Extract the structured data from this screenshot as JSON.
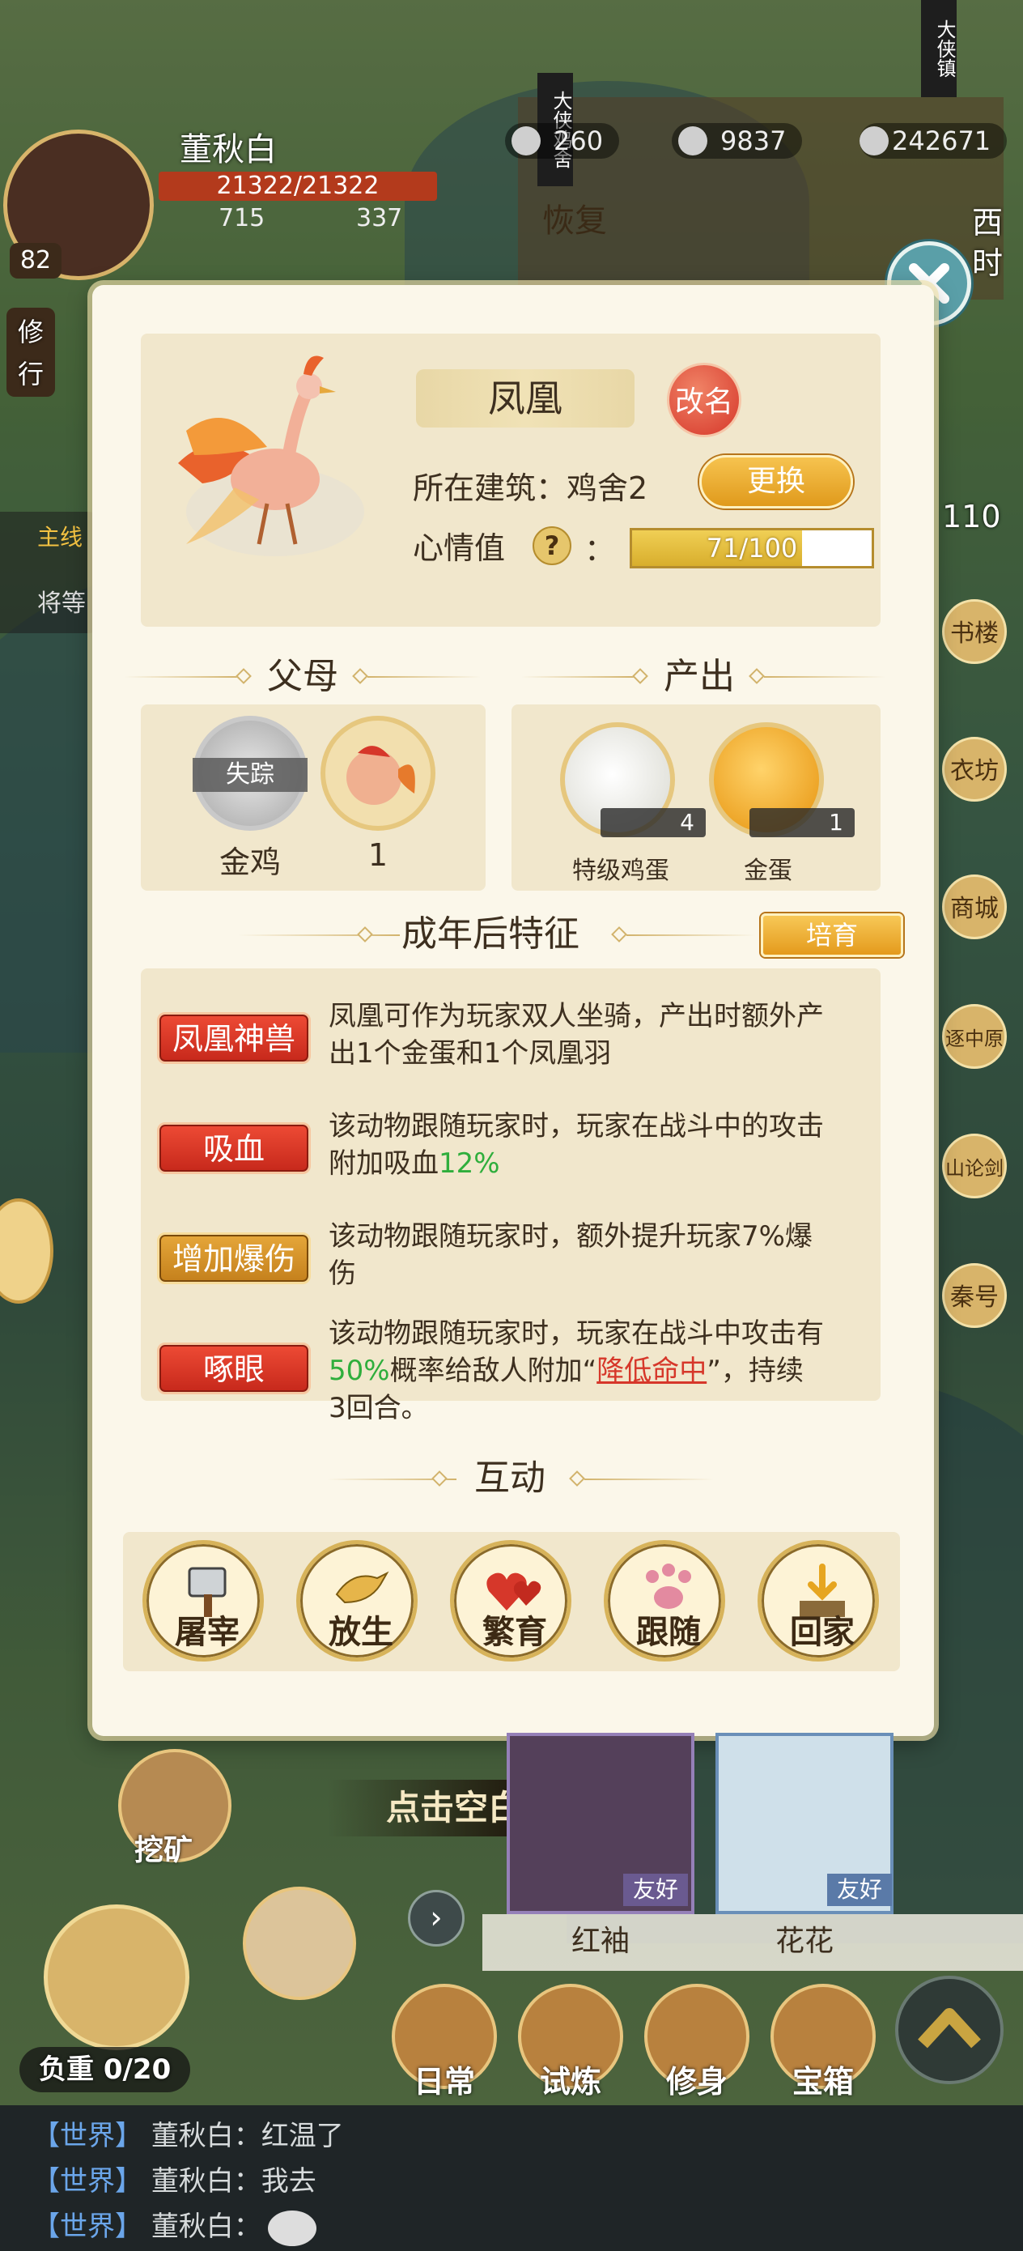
{
  "hud": {
    "player_name": "董秋白",
    "hp": "21322/21322",
    "level": "82",
    "stat_a": "715",
    "stat_b": "337",
    "practice_label": "修行",
    "restore_label": "恢复",
    "resource_1": "260",
    "resource_2": "9837",
    "resource_3": "242671",
    "badge_vertical_1": "大侠鸡舍",
    "badge_vertical_2": "大侠镇",
    "time_label": "西时",
    "side_value": "110",
    "quest_prefix": "主线",
    "quest_text": "将等"
  },
  "side_menu": [
    "书楼",
    "衣坊",
    "商城",
    "逐中原",
    "山论剑",
    "秦号"
  ],
  "pet": {
    "name": "凤凰",
    "rename_label": "改名",
    "building_label": "所在建筑：鸡舍2",
    "change_label": "更换",
    "mood_label": "心情值",
    "mood_help": "?",
    "mood_colon": "：",
    "mood_text": "71/100",
    "mood_value": 71,
    "mood_max": 100
  },
  "parents": {
    "title": "父母",
    "parent_1": {
      "name": "金鸡",
      "status": "失踪"
    },
    "parent_2": {
      "name": "1"
    }
  },
  "output": {
    "title": "产出",
    "items": [
      {
        "name": "特级鸡蛋",
        "count": "4"
      },
      {
        "name": "金蛋",
        "count": "1"
      }
    ]
  },
  "traits": {
    "title": "成年后特征",
    "cultivate_label": "培育",
    "items": [
      {
        "tag": "凤凰神兽",
        "line1": "凤凰可作为玩家双人坐骑，产出时额外产",
        "line2": "出1个金蛋和1个凤凰羽"
      },
      {
        "tag": "吸血",
        "line1": "该动物跟随玩家时，玩家在战斗中的攻击",
        "line2_pre": "附加吸血",
        "line2_hl": "12%"
      },
      {
        "tag": "增加爆伤",
        "line1": "该动物跟随玩家时，额外提升玩家7%爆",
        "line2": "伤"
      },
      {
        "tag": "啄眼",
        "line1": "该动物跟随玩家时，玩家在战斗中攻击有",
        "line2_hl": "50%",
        "line2_mid": "概率给敌人附加“",
        "line2_link": "降低命中",
        "line2_post": "”，持续",
        "line3": "3回合。"
      }
    ]
  },
  "interact": {
    "title": "互动",
    "buttons": [
      "屠宰",
      "放生",
      "繁育",
      "跟随",
      "回家"
    ]
  },
  "close_hint": "点击空白处关闭",
  "npcs": [
    {
      "name": "红袖",
      "badge": "友好"
    },
    {
      "name": "花花",
      "badge": "友好"
    }
  ],
  "mine_label": "挖矿",
  "load_label": "负重 0/20",
  "bottom_nav": [
    "日常",
    "试炼",
    "修身",
    "宝箱"
  ],
  "chat": [
    {
      "channel": "【世界】",
      "text": "董秋白：红温了"
    },
    {
      "channel": "【世界】",
      "text": "董秋白：我去"
    },
    {
      "channel": "【世界】",
      "text": "董秋白："
    }
  ],
  "colors": {
    "accent_red": "#d6372a",
    "highlight_green": "#2fae3c",
    "gold": "#e6b54a",
    "panel": "#fbf7ea"
  }
}
